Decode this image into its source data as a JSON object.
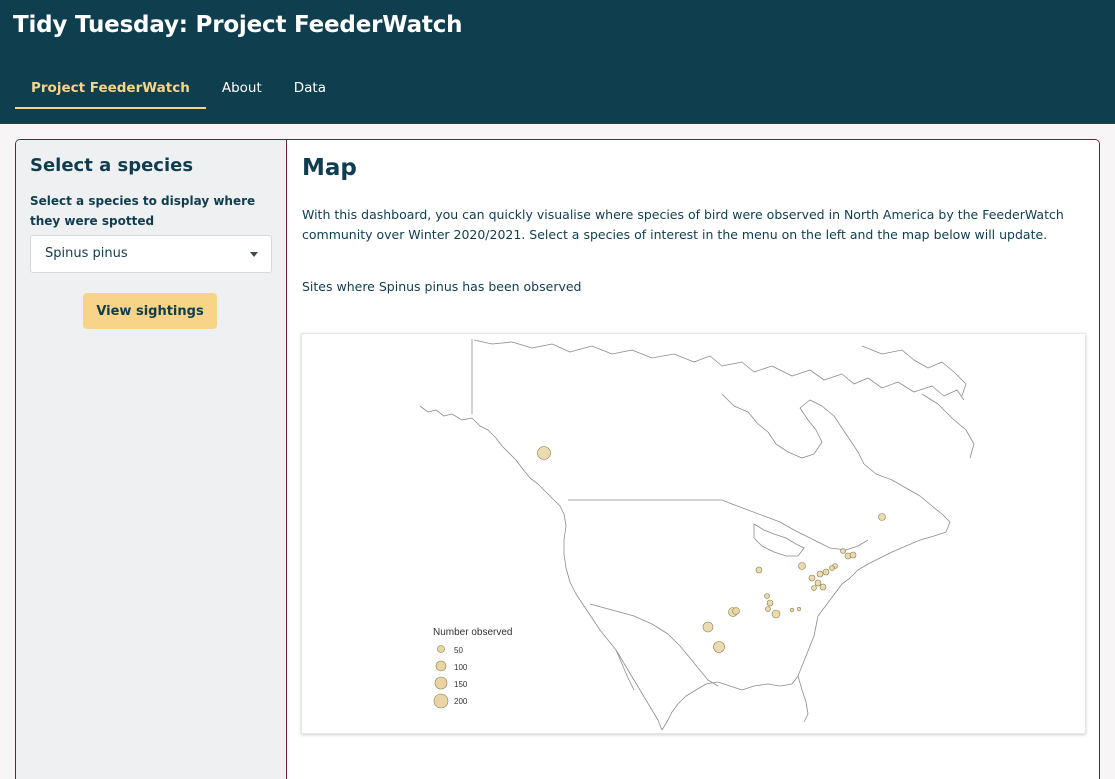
{
  "app": {
    "title": "Tidy Tuesday: Project FeederWatch"
  },
  "nav": {
    "tabs": [
      {
        "label": "Project FeederWatch",
        "active": true
      },
      {
        "label": "About",
        "active": false
      },
      {
        "label": "Data",
        "active": false
      }
    ]
  },
  "sidebar": {
    "title": "Select a species",
    "select_label": "Select a species to display where they were spotted",
    "select_value": "Spinus pinus",
    "button_label": "View sightings"
  },
  "main": {
    "title": "Map",
    "intro": "With this dashboard, you can quickly visualise where species of bird were observed in North America by the FeederWatch community over Winter 2020/2021. Select a species of interest in the menu on the left and the map below will update.",
    "sites_text": "Sites where Spinus pinus has been observed"
  },
  "map": {
    "legend_title": "Number observed",
    "legend": [
      {
        "label": "50",
        "value": 50
      },
      {
        "label": "100",
        "value": 100
      },
      {
        "label": "150",
        "value": 150
      },
      {
        "label": "200",
        "value": 200
      }
    ],
    "colors": {
      "point_fill": "#e8d5a3",
      "point_stroke": "#8a7a4a",
      "coast": "#8c8c8c"
    }
  }
}
